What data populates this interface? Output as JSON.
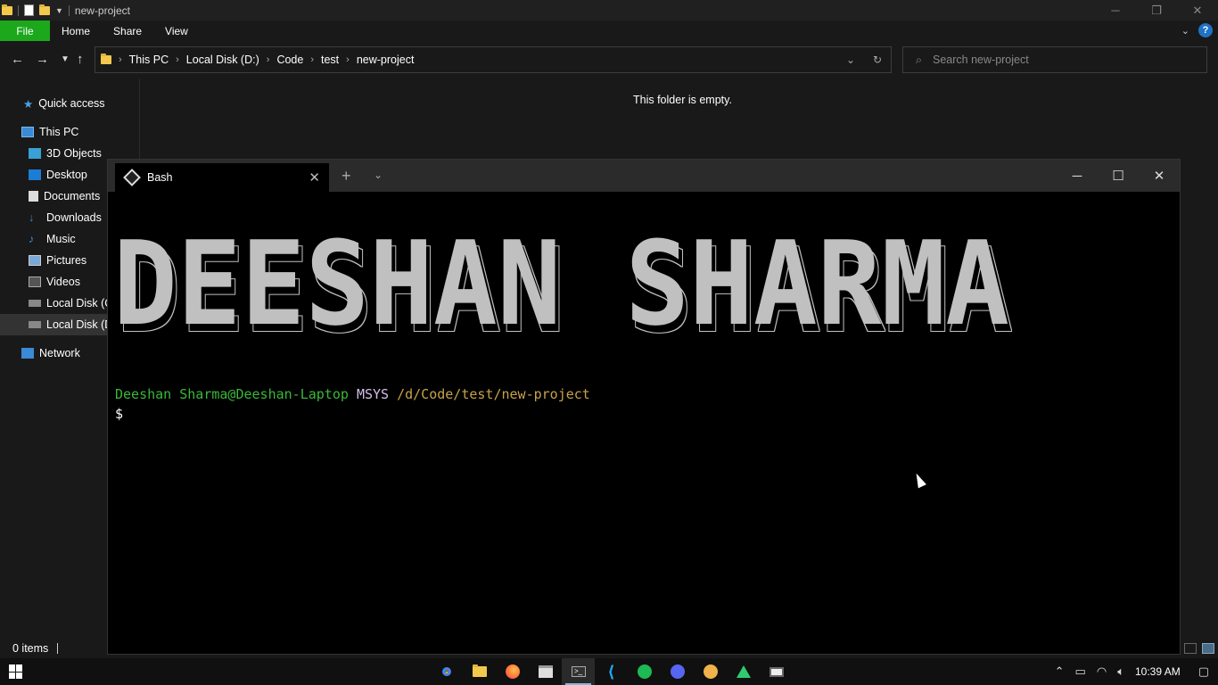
{
  "explorer": {
    "window_title": "new-project",
    "ribbon_tabs": [
      "File",
      "Home",
      "Share",
      "View"
    ],
    "breadcrumbs": [
      "This PC",
      "Local Disk (D:)",
      "Code",
      "test",
      "new-project"
    ],
    "search_placeholder": "Search new-project",
    "empty_message": "This folder is empty.",
    "status_items": "0 items",
    "nav": {
      "quick_access": "Quick access",
      "this_pc": "This PC",
      "items": [
        "3D Objects",
        "Desktop",
        "Documents",
        "Downloads",
        "Music",
        "Pictures",
        "Videos",
        "Local Disk (C",
        "Local Disk (D"
      ],
      "network": "Network"
    }
  },
  "terminal": {
    "tab_label": "Bash",
    "banner_text": "DEESHAN SHARMA",
    "prompt_user": "Deeshan Sharma@Deeshan-Laptop",
    "prompt_system": "MSYS",
    "prompt_path": "/d/Code/test/new-project",
    "prompt_symbol": "$"
  },
  "taskbar": {
    "clock": "10:39 AM",
    "apps": [
      "chrome-icon",
      "file-explorer-icon",
      "firefox-icon",
      "store-icon",
      "terminal-icon",
      "vscode-icon",
      "spotify-icon",
      "discord-icon",
      "clock-app-icon",
      "home-app-icon",
      "screen-icon"
    ]
  },
  "colors": {
    "file_tab": "#1ba81b",
    "prompt_user": "#3ab83a",
    "prompt_system": "#d3bfe9",
    "prompt_path": "#c7a24a",
    "banner": "#c0c0c0"
  }
}
